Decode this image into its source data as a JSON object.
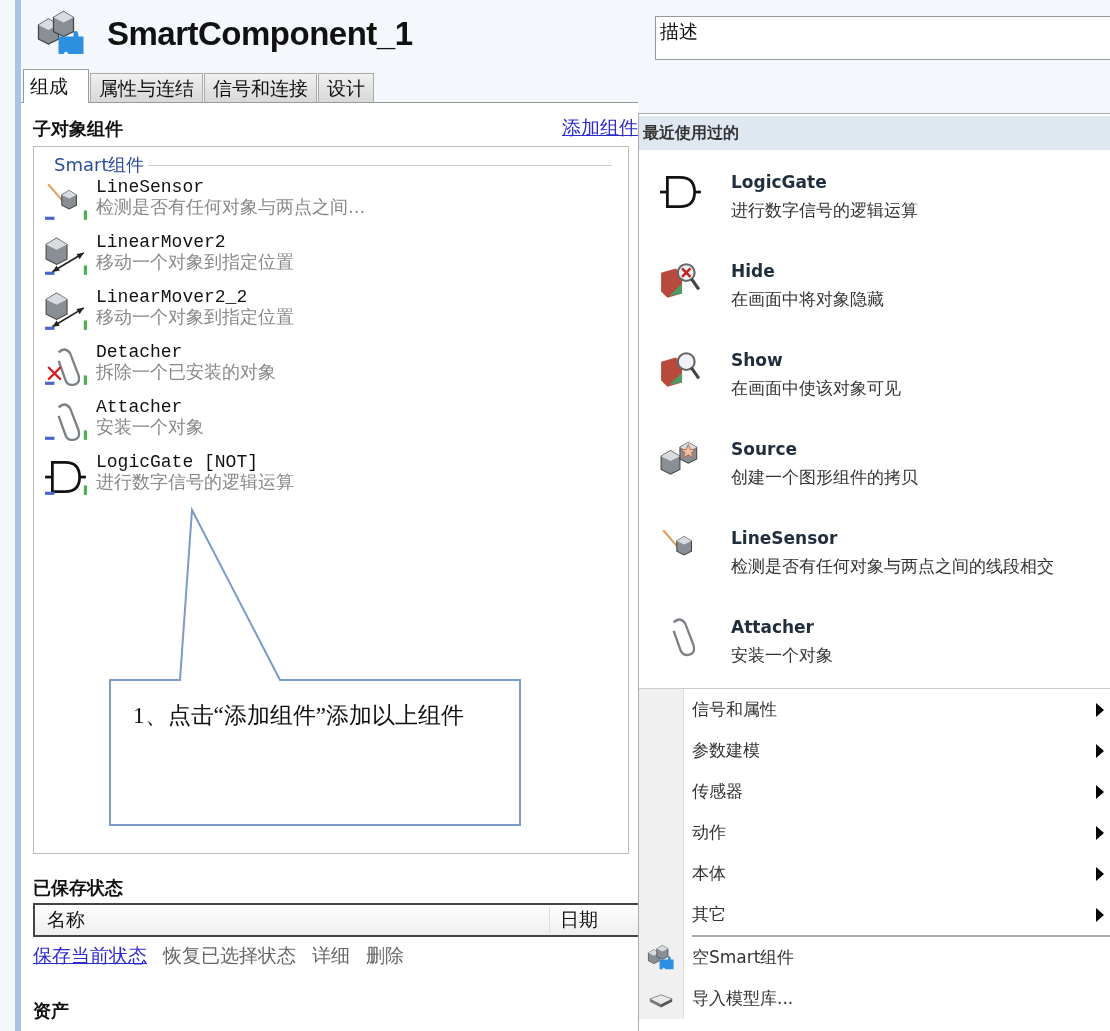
{
  "header": {
    "title": "SmartComponent_1",
    "description_field": {
      "value": "描述"
    }
  },
  "tabs": [
    {
      "label": "组成",
      "selected": true
    },
    {
      "label": "属性与连结",
      "selected": false
    },
    {
      "label": "信号和连接",
      "selected": false
    },
    {
      "label": "设计",
      "selected": false
    }
  ],
  "children_section": {
    "title": "子对象组件",
    "add_link": "添加组件",
    "group_label": "Smart组件",
    "items": [
      {
        "name": "LineSensor",
        "description": "检测是否有任何对象与两点之间...",
        "kind": "sensor"
      },
      {
        "name": "LinearMover2",
        "description": "移动一个对象到指定位置",
        "kind": "mover"
      },
      {
        "name": "LinearMover2_2",
        "description": "移动一个对象到指定位置",
        "kind": "mover"
      },
      {
        "name": "Detacher",
        "description": "拆除一个已安装的对象",
        "kind": "detacher"
      },
      {
        "name": "Attacher",
        "description": "安装一个对象",
        "kind": "attacher"
      },
      {
        "name": "LogicGate [NOT]",
        "description": "进行数字信号的逻辑运算",
        "kind": "logic"
      }
    ]
  },
  "callout": {
    "text": "1、点击“添加组件”添加以上组件"
  },
  "saved_states": {
    "title": "已保存状态",
    "columns": [
      "名称",
      "日期"
    ],
    "actions": [
      {
        "label": "保存当前状态",
        "kind": "link"
      },
      {
        "label": "恢复已选择状态",
        "kind": "plain"
      },
      {
        "label": "详细",
        "kind": "plain"
      },
      {
        "label": "删除",
        "kind": "plain"
      }
    ]
  },
  "assets": {
    "title": "资产"
  },
  "menu": {
    "header": "最近使用过的",
    "recent": [
      {
        "name": "LogicGate",
        "description": "进行数字信号的逻辑运算",
        "kind": "logic"
      },
      {
        "name": "Hide",
        "description": "在画面中将对象隐藏",
        "kind": "hide"
      },
      {
        "name": "Show",
        "description": "在画面中使该对象可见",
        "kind": "show"
      },
      {
        "name": "Source",
        "description": "创建一个图形组件的拷贝",
        "kind": "source"
      },
      {
        "name": "LineSensor",
        "description": "检测是否有任何对象与两点之间的线段相交",
        "kind": "sensor"
      },
      {
        "name": "Attacher",
        "description": "安装一个对象",
        "kind": "attacher"
      }
    ],
    "submenus": [
      "信号和属性",
      "参数建模",
      "传感器",
      "动作",
      "本体",
      "其它"
    ],
    "commands": [
      {
        "label": "空Smart组件",
        "kind": "smart"
      },
      {
        "label": "导入模型库...",
        "kind": "library"
      }
    ]
  }
}
